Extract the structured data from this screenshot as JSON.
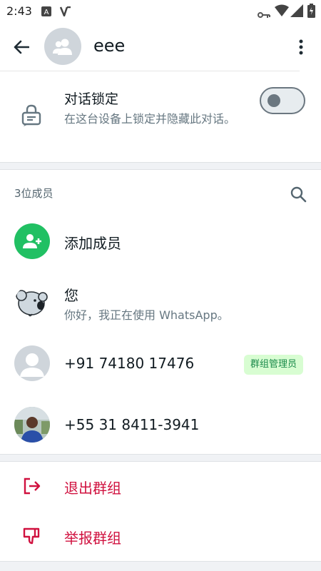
{
  "status_bar": {
    "time": "2:43",
    "icons": [
      "keyboard-icon",
      "vpn-icon",
      "key-icon",
      "wifi-icon",
      "signal-icon",
      "battery-icon"
    ]
  },
  "app_bar": {
    "group_name": "eee"
  },
  "chat_lock": {
    "title": "对话锁定",
    "description": "在这台设备上锁定并隐藏此对话。",
    "enabled": false
  },
  "members": {
    "count_label": "3位成员",
    "add_member_label": "添加成员",
    "list": [
      {
        "name": "您",
        "status": "你好，我正在使用 WhatsApp。",
        "avatar": "koala-icon"
      },
      {
        "name": "+91 74180 17476",
        "badge": "群组管理员",
        "avatar": "default-person-icon"
      },
      {
        "name": "+55 31 8411-3941",
        "avatar": "photo"
      }
    ]
  },
  "actions": {
    "exit_group": "退出群组",
    "report_group": "举报群组"
  },
  "colors": {
    "accent_green": "#25d366",
    "danger_red": "#d0113f",
    "admin_badge_bg": "#d8fdd2",
    "admin_badge_text": "#1b8a4a"
  }
}
